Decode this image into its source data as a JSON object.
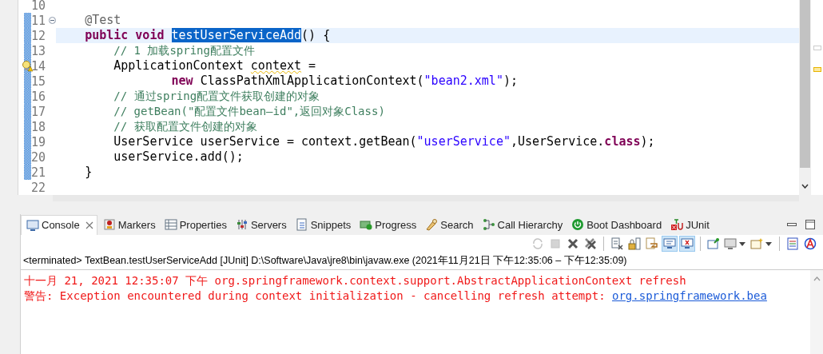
{
  "editor": {
    "lines": [
      {
        "number": "10",
        "changed": false,
        "foldable": false,
        "warning": false,
        "current": false
      },
      {
        "number": "11",
        "changed": true,
        "foldable": true,
        "warning": false,
        "current": false,
        "segments": [
          {
            "kind": "annotation",
            "text": "    @Test"
          }
        ]
      },
      {
        "number": "12",
        "changed": true,
        "foldable": false,
        "warning": false,
        "current": true,
        "segments": [
          {
            "kind": "keyword",
            "text": "    public"
          },
          {
            "kind": "keyword",
            "text": " void"
          },
          {
            "kind": "selected",
            "text": " testUserServiceAdd"
          },
          {
            "kind": "plain",
            "text": "() {"
          }
        ]
      },
      {
        "number": "13",
        "changed": true,
        "foldable": false,
        "warning": false,
        "current": false,
        "segments": [
          {
            "kind": "comment",
            "text": "        // 1 加载spring配置文件"
          }
        ]
      },
      {
        "number": "14",
        "changed": true,
        "foldable": false,
        "warning": true,
        "current": false,
        "segments": [
          {
            "kind": "plain",
            "text": "        ApplicationContext"
          },
          {
            "kind": "warned",
            "text": " context"
          },
          {
            "kind": "plain",
            "text": " ="
          }
        ]
      },
      {
        "number": "15",
        "changed": true,
        "foldable": false,
        "warning": false,
        "current": false,
        "segments": [
          {
            "kind": "keyword",
            "text": "                new"
          },
          {
            "kind": "plain",
            "text": " ClassPathXmlApplicationContext("
          },
          {
            "kind": "string",
            "text": "\"bean2.xml\""
          },
          {
            "kind": "plain",
            "text": ");"
          }
        ]
      },
      {
        "number": "16",
        "changed": true,
        "foldable": false,
        "warning": false,
        "current": false,
        "segments": [
          {
            "kind": "comment",
            "text": "        // 通过spring配置文件获取创建的对象"
          }
        ]
      },
      {
        "number": "17",
        "changed": true,
        "foldable": false,
        "warning": false,
        "current": false,
        "segments": [
          {
            "kind": "comment",
            "text": "        // getBean(\"配置文件bean—id\",返回对象Class)"
          }
        ]
      },
      {
        "number": "18",
        "changed": true,
        "foldable": false,
        "warning": false,
        "current": false,
        "segments": [
          {
            "kind": "comment",
            "text": "        // 获取配置文件创建的对象"
          }
        ]
      },
      {
        "number": "19",
        "changed": true,
        "foldable": false,
        "warning": false,
        "current": false,
        "segments": [
          {
            "kind": "plain",
            "text": "        UserService userService = context.getBean("
          },
          {
            "kind": "string",
            "text": "\"userService\""
          },
          {
            "kind": "plain",
            "text": ",UserService."
          },
          {
            "kind": "keyword",
            "text": "class"
          },
          {
            "kind": "plain",
            "text": ");"
          }
        ]
      },
      {
        "number": "20",
        "changed": true,
        "foldable": false,
        "warning": false,
        "current": false,
        "segments": [
          {
            "kind": "plain",
            "text": "        userService.add();"
          }
        ]
      },
      {
        "number": "21",
        "changed": true,
        "foldable": false,
        "warning": false,
        "current": false,
        "segments": [
          {
            "kind": "plain",
            "text": "    }"
          }
        ]
      },
      {
        "number": "22",
        "changed": false,
        "foldable": false,
        "warning": false,
        "current": false
      }
    ]
  },
  "console": {
    "tabs": [
      {
        "kind": "console",
        "label": "Console",
        "selected": true
      },
      {
        "kind": "markers",
        "label": "Markers",
        "selected": false
      },
      {
        "kind": "properties",
        "label": "Properties",
        "selected": false
      },
      {
        "kind": "servers",
        "label": "Servers",
        "selected": false
      },
      {
        "kind": "snippets",
        "label": "Snippets",
        "selected": false
      },
      {
        "kind": "progress",
        "label": "Progress",
        "selected": false
      },
      {
        "kind": "search",
        "label": "Search",
        "selected": false
      },
      {
        "kind": "hierarchy",
        "label": "Call Hierarchy",
        "selected": false
      },
      {
        "kind": "boot",
        "label": "Boot Dashboard",
        "selected": false
      },
      {
        "kind": "junit",
        "label": "JUnit",
        "selected": false
      }
    ],
    "toolbar": [
      {
        "buttons": [
          {
            "kind": "relaunch",
            "disabled": true,
            "pressed": false,
            "menu": false
          },
          {
            "kind": "terminate",
            "disabled": true,
            "pressed": false,
            "menu": false
          },
          {
            "kind": "remove",
            "disabled": false,
            "pressed": false,
            "menu": false
          },
          {
            "kind": "remove-all",
            "disabled": false,
            "pressed": false,
            "menu": false
          }
        ]
      },
      {
        "buttons": [
          {
            "kind": "clear",
            "disabled": false,
            "pressed": false,
            "menu": false
          },
          {
            "kind": "lock",
            "disabled": false,
            "pressed": false,
            "menu": false
          },
          {
            "kind": "wrap",
            "disabled": false,
            "pressed": false,
            "menu": false
          },
          {
            "kind": "stdout",
            "disabled": false,
            "pressed": true,
            "menu": false
          },
          {
            "kind": "stderr",
            "disabled": false,
            "pressed": true,
            "menu": false
          }
        ]
      },
      {
        "buttons": [
          {
            "kind": "pin",
            "disabled": false,
            "pressed": false,
            "menu": false
          },
          {
            "kind": "display",
            "disabled": false,
            "pressed": false,
            "menu": true
          },
          {
            "kind": "new-console",
            "disabled": false,
            "pressed": false,
            "menu": true
          }
        ]
      },
      {
        "buttons": [
          {
            "kind": "report",
            "disabled": false,
            "pressed": false,
            "menu": false
          },
          {
            "kind": "spring",
            "disabled": false,
            "pressed": false,
            "menu": false
          }
        ]
      }
    ],
    "process": "<terminated> TextBean.testUserServiceAdd [JUnit] D:\\Software\\Java\\jre8\\bin\\javaw.exe  (2021年11月21日 下午12:35:06 – 下午12:35:09)",
    "output": [
      {
        "segments": [
          {
            "kind": "error",
            "text": "十一月 21, 2021 12:35:07 下午 org.springframework.context.support.AbstractApplicationContext refresh"
          }
        ]
      },
      {
        "segments": [
          {
            "kind": "error",
            "text": "警告: Exception encountered during context initialization - cancelling refresh attempt: "
          },
          {
            "kind": "link",
            "text": "org.springframework.bea"
          }
        ]
      }
    ]
  }
}
